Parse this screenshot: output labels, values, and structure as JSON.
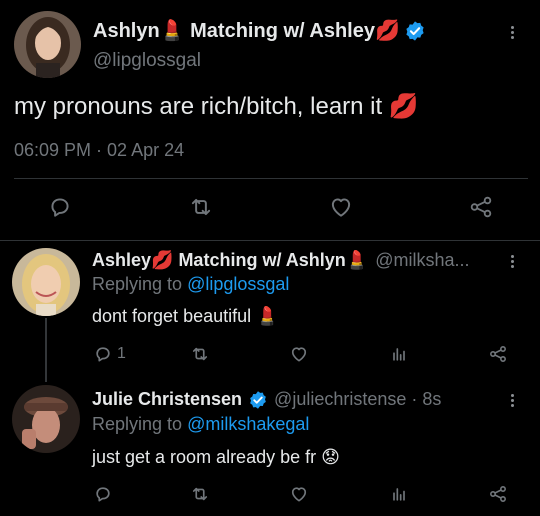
{
  "main_tweet": {
    "display_name": "Ashlyn💄 Matching w/ Ashley💋",
    "handle": "@lipglossgal",
    "text": "my pronouns are rich/bitch, learn it 💋",
    "timestamp": "06:09 PM · 02 Apr 24"
  },
  "reply1": {
    "display_name": "Ashley💋 Matching w/ Ashlyn💄",
    "handle": "@milksha...",
    "replying_prefix": "Replying to",
    "replying_handle": "@lipglossgal",
    "text": "dont forget beautiful 💄",
    "reply_count": "1"
  },
  "reply2": {
    "display_name": "Julie Christensen",
    "handle": "@juliechristense · 8s",
    "replying_prefix": "Replying to",
    "replying_handle": "@milkshakegal",
    "text": "just get a room already be fr 😟"
  },
  "colors": {
    "background": "#000000",
    "text": "#e7e9ea",
    "secondary": "#71767b",
    "link": "#1d9bf0",
    "verified": "#1d9bf0"
  }
}
